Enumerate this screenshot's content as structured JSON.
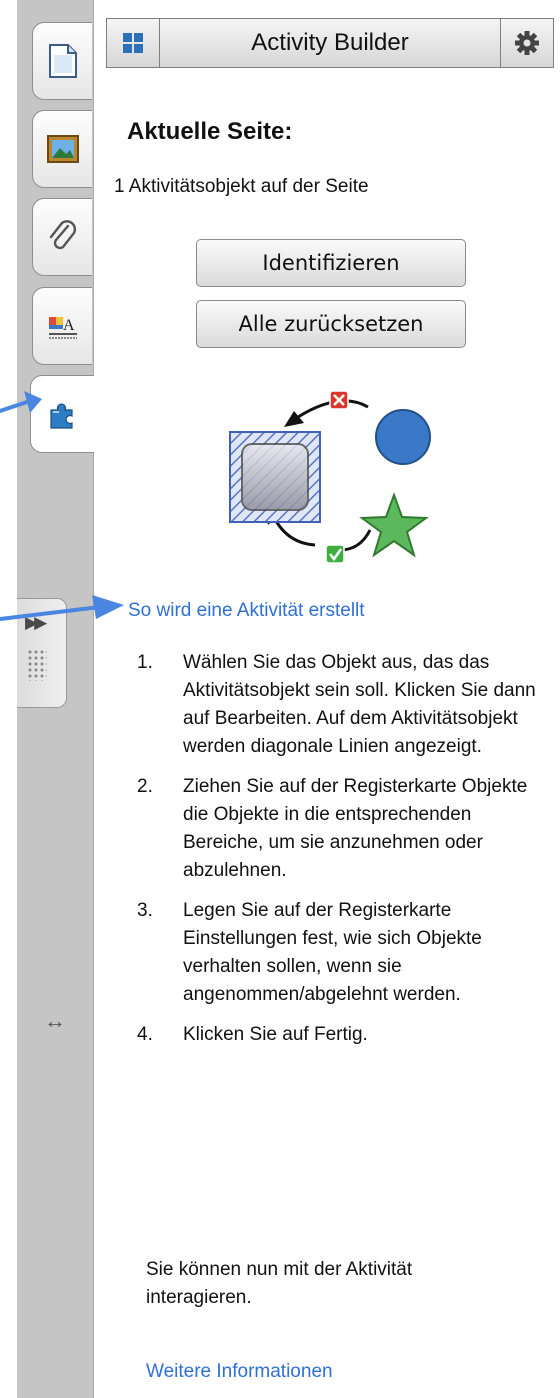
{
  "toolbar": {
    "title": "Activity Builder",
    "grid_icon": "grid-icon",
    "gear_icon": "gear-icon"
  },
  "sidebar": {
    "tabs": [
      {
        "name": "page-sorter",
        "icon": "page-icon",
        "active": false
      },
      {
        "name": "gallery",
        "icon": "picture-icon",
        "active": false
      },
      {
        "name": "attachments",
        "icon": "paperclip-icon",
        "active": false
      },
      {
        "name": "properties",
        "icon": "properties-icon",
        "active": false
      },
      {
        "name": "add-ons",
        "icon": "puzzle-icon",
        "active": true
      }
    ],
    "expand_icon": "double-chevron-icon",
    "resize_icon": "resize-horizontal-icon"
  },
  "panel": {
    "heading": "Aktuelle Seite:",
    "count_text": "1 Aktivitätsobjekt auf der Seite",
    "identify_label": "Identifizieren",
    "reset_label": "Alle zurücksetzen",
    "howto_link": "So wird eine Aktivität erstellt",
    "steps": [
      {
        "num": "1.",
        "text": "Wählen Sie das Objekt aus, das das Aktivitätsobjekt sein soll. Klicken Sie dann auf Bearbeiten. Auf dem Aktivitätsobjekt werden diagonale Linien angezeigt."
      },
      {
        "num": "2.",
        "text": "Ziehen Sie auf der Registerkarte Objekte die Objekte in die entsprechenden Bereiche, um sie anzunehmen oder abzulehnen."
      },
      {
        "num": "3.",
        "text": "Legen Sie auf der Registerkarte Einstellungen fest, wie sich Objekte verhalten sollen, wenn sie angenommen/abgelehnt werden."
      },
      {
        "num": "4.",
        "text": "Klicken Sie auf Fertig."
      }
    ],
    "note": "Sie können nun mit der Aktivität interagieren.",
    "more_link": "Weitere Informationen"
  },
  "colors": {
    "link": "#2f6fd6",
    "arrow": "#4a86e0",
    "circle": "#3a78c8",
    "star": "#5cb85c",
    "reject": "#d9372b",
    "accept": "#3fae3f"
  }
}
